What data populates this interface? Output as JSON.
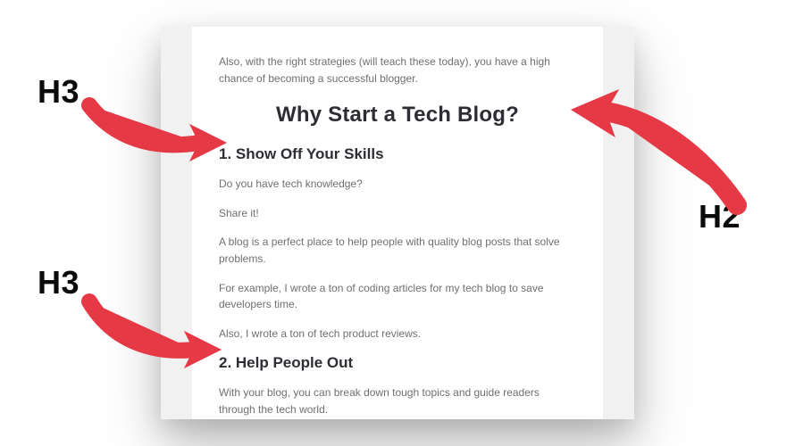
{
  "labels": {
    "h3_marker_1": "H3",
    "h3_marker_2": "H3",
    "h2_marker": "H2"
  },
  "card": {
    "intro": "Also, with the right strategies (will teach these today), you have a high chance of becoming a successful blogger.",
    "h2": "Why Start a Tech Blog?",
    "section1": {
      "heading": "1. Show Off Your Skills",
      "p1": "Do you have tech knowledge?",
      "p2": "Share it!",
      "p3": "A blog is a perfect place to help people with quality blog posts that solve problems.",
      "p4": "For example, I wrote a ton of coding articles for my tech blog to save developers time.",
      "p5": "Also, I wrote a ton of tech product reviews."
    },
    "section2": {
      "heading": "2. Help People Out",
      "p1": "With your blog, you can break down tough topics and guide readers through the tech world."
    }
  },
  "colors": {
    "arrow": "#e63946",
    "headings": "#2d2d33",
    "body_text": "#6f6f74",
    "side_strip": "#f1f1f2"
  }
}
